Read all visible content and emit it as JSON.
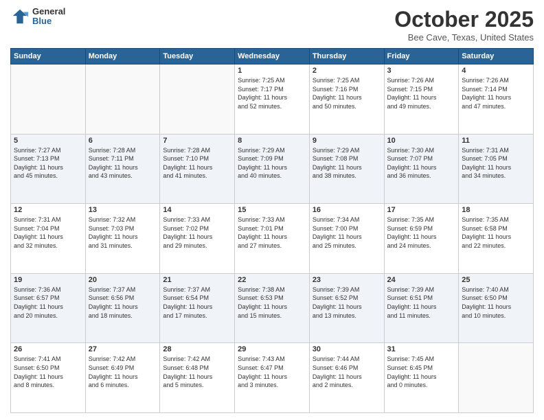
{
  "logo": {
    "general": "General",
    "blue": "Blue"
  },
  "header": {
    "month": "October 2025",
    "location": "Bee Cave, Texas, United States"
  },
  "weekdays": [
    "Sunday",
    "Monday",
    "Tuesday",
    "Wednesday",
    "Thursday",
    "Friday",
    "Saturday"
  ],
  "weeks": [
    [
      {
        "day": "",
        "info": ""
      },
      {
        "day": "",
        "info": ""
      },
      {
        "day": "",
        "info": ""
      },
      {
        "day": "1",
        "info": "Sunrise: 7:25 AM\nSunset: 7:17 PM\nDaylight: 11 hours\nand 52 minutes."
      },
      {
        "day": "2",
        "info": "Sunrise: 7:25 AM\nSunset: 7:16 PM\nDaylight: 11 hours\nand 50 minutes."
      },
      {
        "day": "3",
        "info": "Sunrise: 7:26 AM\nSunset: 7:15 PM\nDaylight: 11 hours\nand 49 minutes."
      },
      {
        "day": "4",
        "info": "Sunrise: 7:26 AM\nSunset: 7:14 PM\nDaylight: 11 hours\nand 47 minutes."
      }
    ],
    [
      {
        "day": "5",
        "info": "Sunrise: 7:27 AM\nSunset: 7:13 PM\nDaylight: 11 hours\nand 45 minutes."
      },
      {
        "day": "6",
        "info": "Sunrise: 7:28 AM\nSunset: 7:11 PM\nDaylight: 11 hours\nand 43 minutes."
      },
      {
        "day": "7",
        "info": "Sunrise: 7:28 AM\nSunset: 7:10 PM\nDaylight: 11 hours\nand 41 minutes."
      },
      {
        "day": "8",
        "info": "Sunrise: 7:29 AM\nSunset: 7:09 PM\nDaylight: 11 hours\nand 40 minutes."
      },
      {
        "day": "9",
        "info": "Sunrise: 7:29 AM\nSunset: 7:08 PM\nDaylight: 11 hours\nand 38 minutes."
      },
      {
        "day": "10",
        "info": "Sunrise: 7:30 AM\nSunset: 7:07 PM\nDaylight: 11 hours\nand 36 minutes."
      },
      {
        "day": "11",
        "info": "Sunrise: 7:31 AM\nSunset: 7:05 PM\nDaylight: 11 hours\nand 34 minutes."
      }
    ],
    [
      {
        "day": "12",
        "info": "Sunrise: 7:31 AM\nSunset: 7:04 PM\nDaylight: 11 hours\nand 32 minutes."
      },
      {
        "day": "13",
        "info": "Sunrise: 7:32 AM\nSunset: 7:03 PM\nDaylight: 11 hours\nand 31 minutes."
      },
      {
        "day": "14",
        "info": "Sunrise: 7:33 AM\nSunset: 7:02 PM\nDaylight: 11 hours\nand 29 minutes."
      },
      {
        "day": "15",
        "info": "Sunrise: 7:33 AM\nSunset: 7:01 PM\nDaylight: 11 hours\nand 27 minutes."
      },
      {
        "day": "16",
        "info": "Sunrise: 7:34 AM\nSunset: 7:00 PM\nDaylight: 11 hours\nand 25 minutes."
      },
      {
        "day": "17",
        "info": "Sunrise: 7:35 AM\nSunset: 6:59 PM\nDaylight: 11 hours\nand 24 minutes."
      },
      {
        "day": "18",
        "info": "Sunrise: 7:35 AM\nSunset: 6:58 PM\nDaylight: 11 hours\nand 22 minutes."
      }
    ],
    [
      {
        "day": "19",
        "info": "Sunrise: 7:36 AM\nSunset: 6:57 PM\nDaylight: 11 hours\nand 20 minutes."
      },
      {
        "day": "20",
        "info": "Sunrise: 7:37 AM\nSunset: 6:56 PM\nDaylight: 11 hours\nand 18 minutes."
      },
      {
        "day": "21",
        "info": "Sunrise: 7:37 AM\nSunset: 6:54 PM\nDaylight: 11 hours\nand 17 minutes."
      },
      {
        "day": "22",
        "info": "Sunrise: 7:38 AM\nSunset: 6:53 PM\nDaylight: 11 hours\nand 15 minutes."
      },
      {
        "day": "23",
        "info": "Sunrise: 7:39 AM\nSunset: 6:52 PM\nDaylight: 11 hours\nand 13 minutes."
      },
      {
        "day": "24",
        "info": "Sunrise: 7:39 AM\nSunset: 6:51 PM\nDaylight: 11 hours\nand 11 minutes."
      },
      {
        "day": "25",
        "info": "Sunrise: 7:40 AM\nSunset: 6:50 PM\nDaylight: 11 hours\nand 10 minutes."
      }
    ],
    [
      {
        "day": "26",
        "info": "Sunrise: 7:41 AM\nSunset: 6:50 PM\nDaylight: 11 hours\nand 8 minutes."
      },
      {
        "day": "27",
        "info": "Sunrise: 7:42 AM\nSunset: 6:49 PM\nDaylight: 11 hours\nand 6 minutes."
      },
      {
        "day": "28",
        "info": "Sunrise: 7:42 AM\nSunset: 6:48 PM\nDaylight: 11 hours\nand 5 minutes."
      },
      {
        "day": "29",
        "info": "Sunrise: 7:43 AM\nSunset: 6:47 PM\nDaylight: 11 hours\nand 3 minutes."
      },
      {
        "day": "30",
        "info": "Sunrise: 7:44 AM\nSunset: 6:46 PM\nDaylight: 11 hours\nand 2 minutes."
      },
      {
        "day": "31",
        "info": "Sunrise: 7:45 AM\nSunset: 6:45 PM\nDaylight: 11 hours\nand 0 minutes."
      },
      {
        "day": "",
        "info": ""
      }
    ]
  ]
}
